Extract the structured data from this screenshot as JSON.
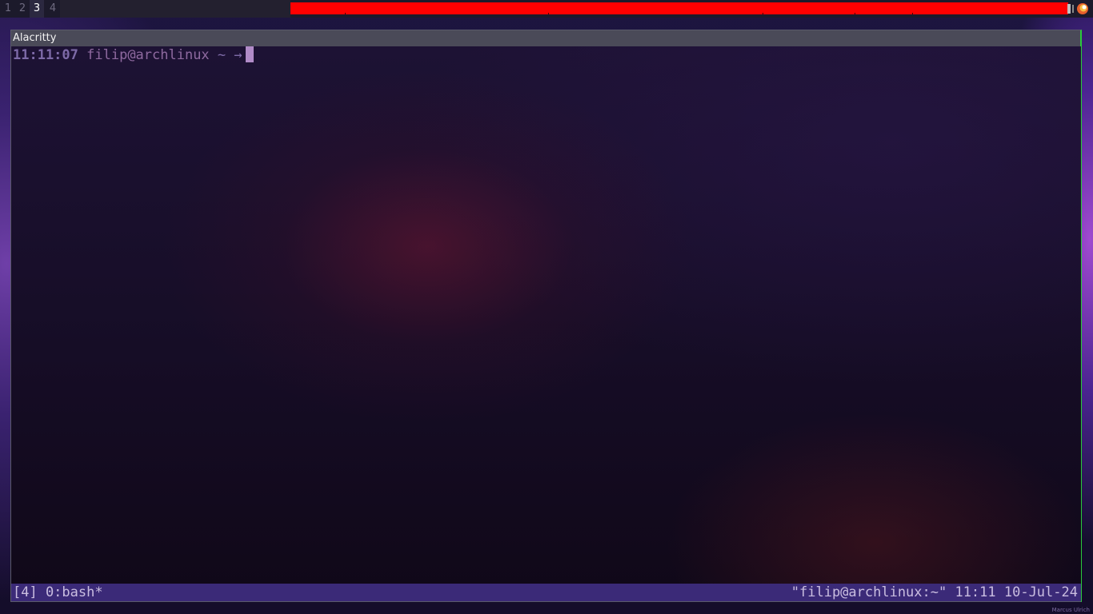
{
  "topbar": {
    "workspaces": [
      {
        "label": "1",
        "active": false
      },
      {
        "label": "2",
        "active": false
      },
      {
        "label": "3",
        "active": true
      },
      {
        "label": "4",
        "active": false
      }
    ],
    "indicator_color": "#ff0000",
    "tray_icon": "firefox-icon"
  },
  "window": {
    "title": "Alacritty",
    "focused_border_color": "#2ac93b"
  },
  "terminal": {
    "prompt_time": "11:11:07",
    "prompt_user": "filip@archlinux",
    "prompt_rest": " ~ →"
  },
  "tmux": {
    "left": "[4] 0:bash*",
    "right": "\"filip@archlinux:~\" 11:11 10-Jul-24",
    "bg_color": "#3b2a78"
  },
  "wallpaper_signature": "Marcus Ulrich"
}
